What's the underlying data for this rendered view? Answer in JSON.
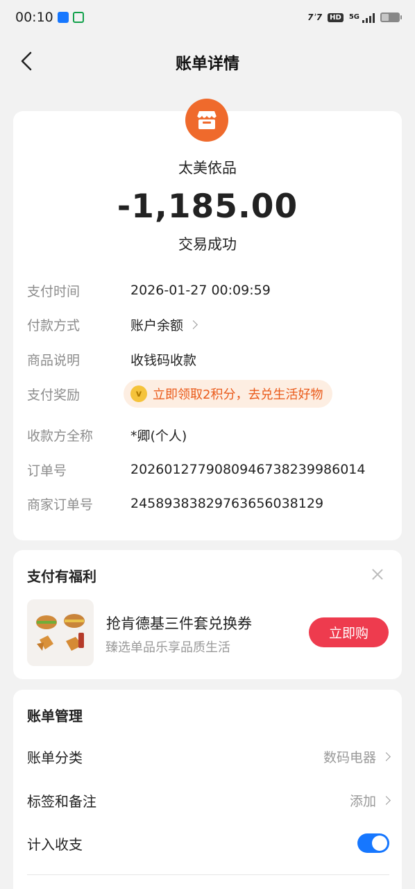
{
  "status_bar": {
    "time": "00:10",
    "network": "7?7",
    "hd": "HD",
    "five_g": "5G",
    "icons": [
      "alipay-app-icon",
      "green-app-icon",
      "signal-icon",
      "battery-icon"
    ]
  },
  "header": {
    "title": "账单详情",
    "back_icon": "chevron-left-icon"
  },
  "transaction": {
    "merchant_name": "太美依品",
    "merchant_icon": "store-icon",
    "amount": "-1,185.00",
    "status": "交易成功",
    "details": [
      {
        "label": "支付时间",
        "value": "2026-01-27 00:09:59"
      },
      {
        "label": "付款方式",
        "value": "账户余额"
      },
      {
        "label": "商品说明",
        "value": "收钱码收款"
      },
      {
        "label": "支付奖励",
        "value": "立即领取2积分，去兑生活好物"
      },
      {
        "label": "收款方全称",
        "value": "*卿(个人)"
      },
      {
        "label": "订单号",
        "value": "2026012779080946738239986014"
      },
      {
        "label": "商家订单号",
        "value": "2458938382976365603812​9"
      }
    ]
  },
  "promo": {
    "title": "支付有福利",
    "item_name": "抢肯德基三件套兑换券",
    "item_sub": "臻选单品乐享品质生活",
    "buy_label": "立即购",
    "buy_color": "#ee3b4e"
  },
  "manage": {
    "title": "账单管理",
    "rows": [
      {
        "label": "账单分类",
        "value": "数码电器"
      },
      {
        "label": "标签和备注",
        "value": "添加"
      },
      {
        "label": "计入收支",
        "value": "on"
      }
    ]
  },
  "colors": {
    "accent": "#ef6a2c",
    "reward_text": "#ea5a1a",
    "reward_bg": "#fdeee2",
    "toggle": "#1677ff"
  }
}
